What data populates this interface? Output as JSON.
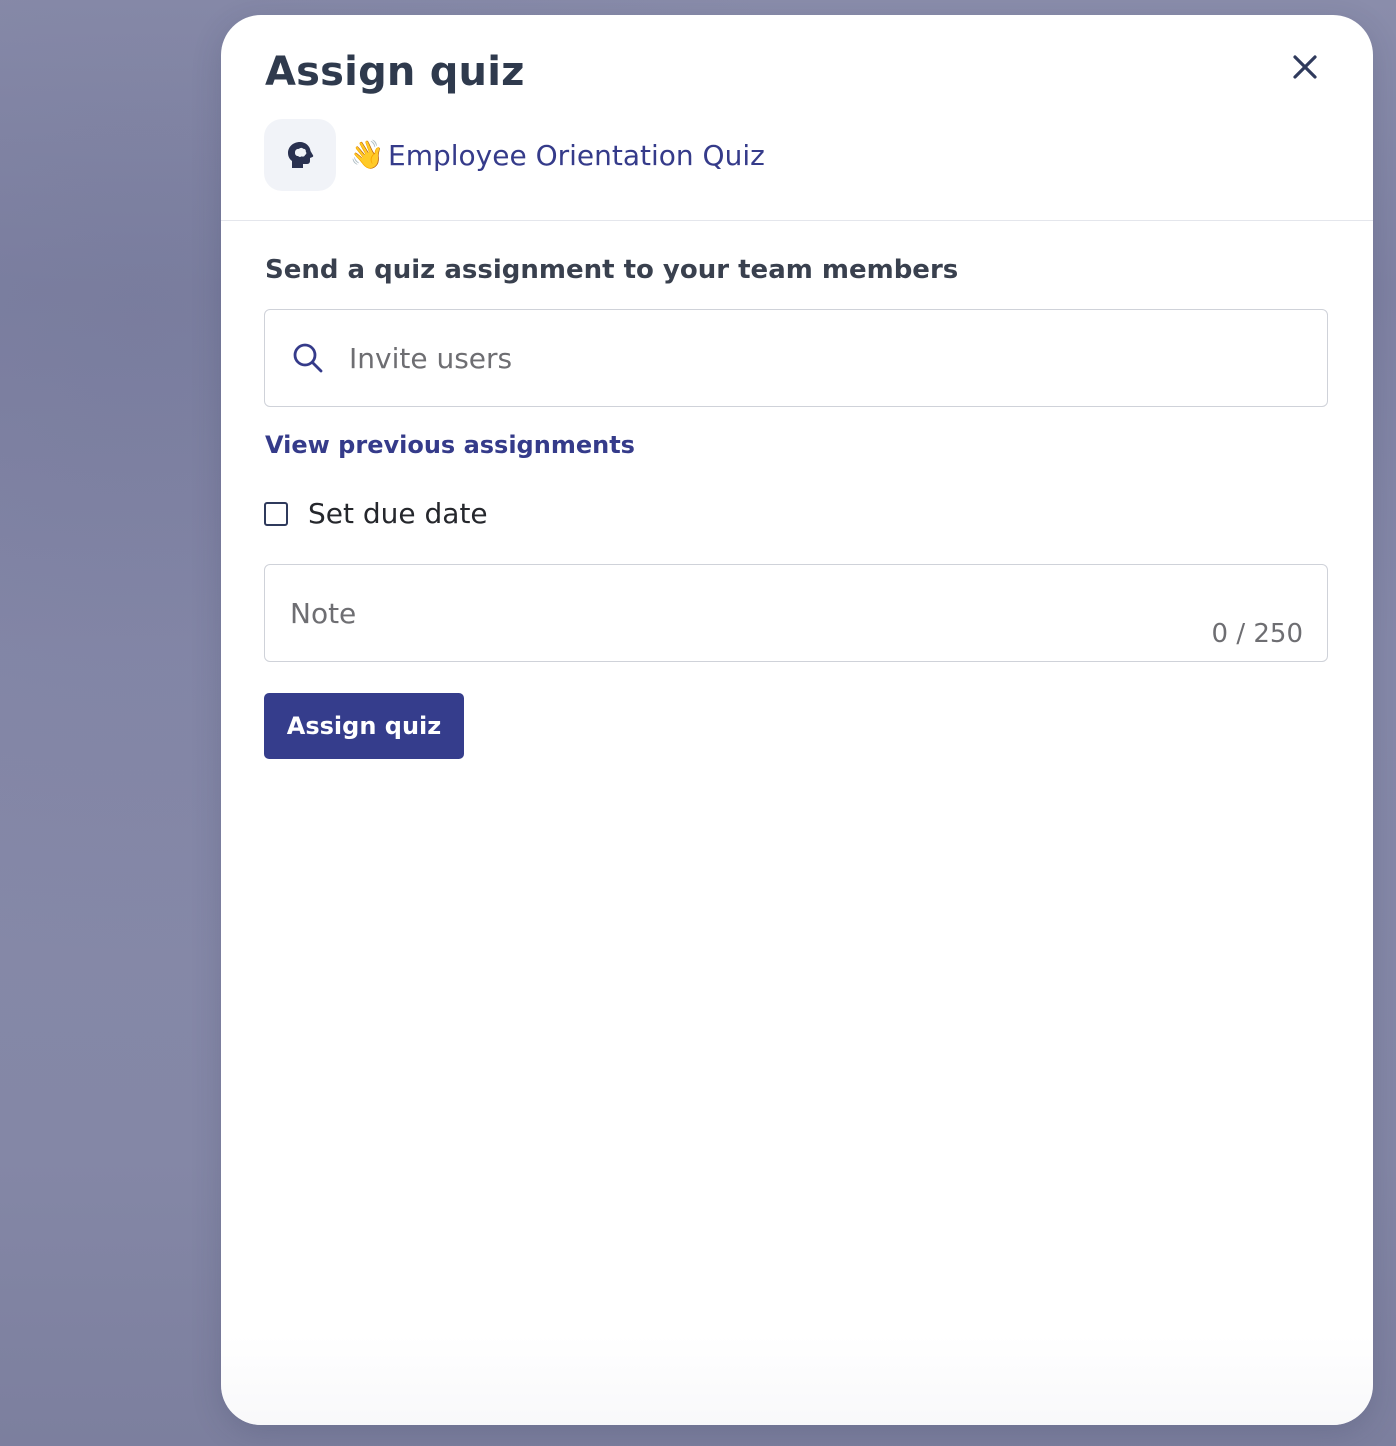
{
  "modal": {
    "title": "Assign quiz",
    "quiz": {
      "emoji": "👋",
      "name": "Employee Orientation Quiz",
      "icon": "brain-head-icon"
    },
    "close_icon": "close-icon"
  },
  "form": {
    "heading": "Send a quiz assignment to your team members",
    "search": {
      "placeholder": "Invite users",
      "value": "",
      "icon": "search-icon"
    },
    "previous_assignments_link": "View previous assignments",
    "due_date": {
      "label": "Set due date",
      "checked": false
    },
    "note": {
      "placeholder": "Note",
      "counter": "0 / 250"
    },
    "submit_label": "Assign quiz"
  },
  "colors": {
    "accent": "#353d8c",
    "link": "#353b8a",
    "title": "#2f3a4d",
    "backdrop": "#8689a9"
  }
}
